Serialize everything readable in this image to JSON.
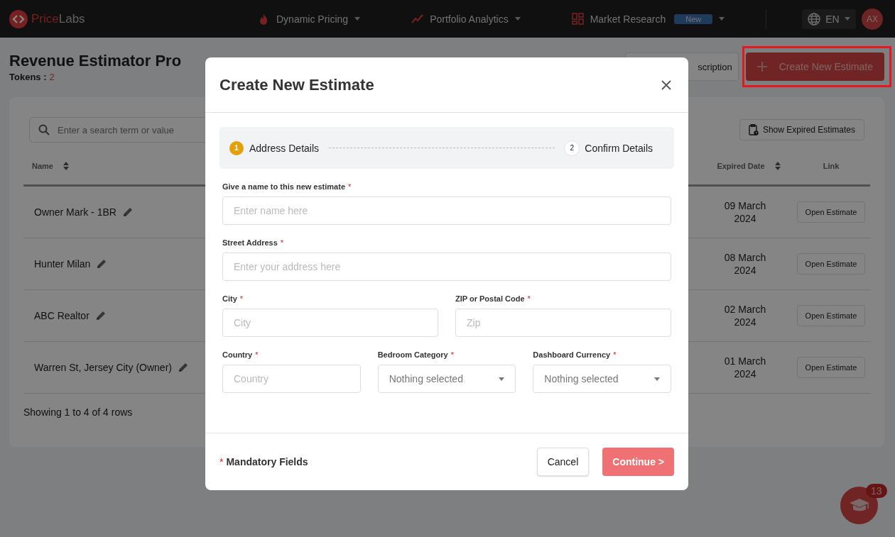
{
  "navbar": {
    "logo": {
      "first": "Price",
      "second": "Labs"
    },
    "items": [
      {
        "label": "Dynamic Pricing"
      },
      {
        "label": "Portfolio Analytics"
      },
      {
        "label": "Market Research",
        "badge": "New"
      }
    ],
    "language": "EN",
    "avatar": "AX"
  },
  "page": {
    "title": "Revenue Estimator Pro",
    "tokens_label": "Tokens :",
    "tokens_value": "2",
    "subscription_button": "scription",
    "create_button": "Create New Estimate",
    "create_highlighted": true
  },
  "table_card": {
    "search": {
      "placeholder": "Enter a search term or value"
    },
    "expired_button": "Show Expired Estimates",
    "columns": [
      {
        "label": "Name",
        "sortable": true
      },
      {
        "label": "Expired Date",
        "sortable": true
      },
      {
        "label": "Link",
        "sortable": false
      }
    ],
    "rows": [
      {
        "name": "Owner Mark - 1BR",
        "expired": [
          "09 March",
          "2024"
        ],
        "link": "Open Estimate"
      },
      {
        "name": "Hunter Milan",
        "expired": [
          "08 March",
          "2024"
        ],
        "link": "Open Estimate"
      },
      {
        "name": "ABC Realtor",
        "expired": [
          "02 March",
          "2024"
        ],
        "link": "Open Estimate"
      },
      {
        "name": "Warren St, Jersey City (Owner)",
        "expired": [
          "01 March",
          "2024"
        ],
        "link": "Open Estimate"
      }
    ],
    "footer": "Showing 1 to 4 of 4 rows"
  },
  "dialog": {
    "title": "Create New Estimate",
    "steps": [
      {
        "number": "1",
        "label": "Address Details",
        "selected": true
      },
      {
        "number": "2",
        "label": "Confirm Details",
        "selected": false
      }
    ],
    "rows": [
      [
        {
          "kind": "input",
          "label": "Give a name to this new estimate",
          "required": true,
          "placeholder": "Enter name here"
        }
      ],
      [
        {
          "kind": "input",
          "label": "Street Address",
          "required": true,
          "placeholder": "Enter your address here"
        }
      ],
      [
        {
          "kind": "input",
          "label": "City",
          "required": true,
          "placeholder": "City"
        },
        {
          "kind": "input",
          "label": "ZIP or Postal Code",
          "required": true,
          "placeholder": "Zip"
        }
      ],
      [
        {
          "kind": "input",
          "label": "Country",
          "required": true,
          "placeholder": "Country"
        },
        {
          "kind": "select",
          "label": "Bedroom Category",
          "required": true,
          "placeholder": "Nothing selected"
        },
        {
          "kind": "select",
          "label": "Dashboard Currency",
          "required": true,
          "placeholder": "Nothing selected"
        }
      ]
    ],
    "required_mark": "*",
    "mandatory_note": "Mandatory Fields",
    "buttons": [
      {
        "kind": "secondary",
        "label": "Cancel"
      },
      {
        "kind": "primary",
        "label": "Continue >"
      }
    ]
  },
  "help": {
    "badge": "13"
  }
}
